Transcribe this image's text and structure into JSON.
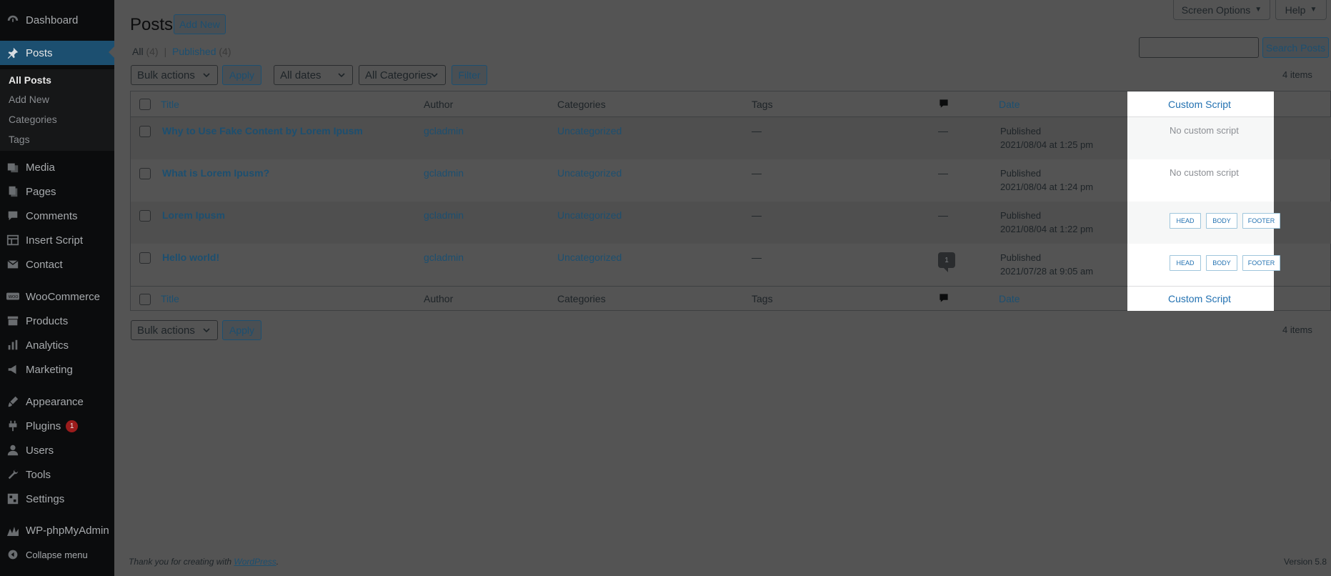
{
  "sidebar": {
    "items": [
      {
        "label": "Dashboard",
        "icon": "dashboard-icon"
      },
      {
        "label": "Posts",
        "icon": "pin-icon"
      },
      {
        "label": "Media",
        "icon": "media-icon"
      },
      {
        "label": "Pages",
        "icon": "pages-icon"
      },
      {
        "label": "Comments",
        "icon": "comments-icon"
      },
      {
        "label": "Insert Script",
        "icon": "table-icon"
      },
      {
        "label": "Contact",
        "icon": "mail-icon"
      },
      {
        "label": "WooCommerce",
        "icon": "woo-icon"
      },
      {
        "label": "Products",
        "icon": "archive-icon"
      },
      {
        "label": "Analytics",
        "icon": "chart-icon"
      },
      {
        "label": "Marketing",
        "icon": "megaphone-icon"
      },
      {
        "label": "Appearance",
        "icon": "brush-icon"
      },
      {
        "label": "Plugins",
        "icon": "plugin-icon",
        "badge": "1"
      },
      {
        "label": "Users",
        "icon": "users-icon"
      },
      {
        "label": "Tools",
        "icon": "wrench-icon"
      },
      {
        "label": "Settings",
        "icon": "settings-icon"
      },
      {
        "label": "WP-phpMyAdmin",
        "icon": "database-icon"
      },
      {
        "label": "Collapse menu",
        "icon": "collapse-icon"
      }
    ],
    "submenu": [
      "All Posts",
      "Add New",
      "Categories",
      "Tags"
    ]
  },
  "header": {
    "title": "Posts",
    "add_new": "Add New",
    "screen_options": "Screen Options",
    "help": "Help",
    "search_button": "Search Posts",
    "search_placeholder": ""
  },
  "views": {
    "all": "All",
    "all_count": "(4)",
    "separator": "|",
    "published": "Published",
    "published_count": "(4)"
  },
  "filters": {
    "bulk_actions": "Bulk actions",
    "apply": "Apply",
    "all_dates": "All dates",
    "all_categories": "All Categories",
    "filter": "Filter",
    "items_count": "4 items"
  },
  "table": {
    "columns": {
      "title": "Title",
      "author": "Author",
      "categories": "Categories",
      "tags": "Tags",
      "date": "Date",
      "custom_script": "Custom Script"
    },
    "rows": [
      {
        "title": "Why to Use Fake Content by Lorem Ipusm",
        "author": "gcladmin",
        "category": "Uncategorized",
        "tags": "—",
        "comments": "—",
        "status": "Published",
        "date": "2021/08/04 at 1:25 pm",
        "script": "No custom script"
      },
      {
        "title": "What is Lorem Ipusm?",
        "author": "gcladmin",
        "category": "Uncategorized",
        "tags": "—",
        "comments": "—",
        "status": "Published",
        "date": "2021/08/04 at 1:24 pm",
        "script": "No custom script"
      },
      {
        "title": "Lorem Ipusm",
        "author": "gcladmin",
        "category": "Uncategorized",
        "tags": "—",
        "comments": "—",
        "status": "Published",
        "date": "2021/08/04 at 1:22 pm",
        "script_buttons": [
          "HEAD",
          "BODY",
          "FOOTER"
        ]
      },
      {
        "title": "Hello world!",
        "author": "gcladmin",
        "category": "Uncategorized",
        "tags": "—",
        "comments": "1",
        "status": "Published",
        "date": "2021/07/28 at 9:05 am",
        "script_buttons": [
          "HEAD",
          "BODY",
          "FOOTER"
        ]
      }
    ]
  },
  "footer": {
    "thanks": "Thank you for creating with",
    "wordpress": "WordPress",
    "period": ".",
    "version": "Version 5.8"
  }
}
